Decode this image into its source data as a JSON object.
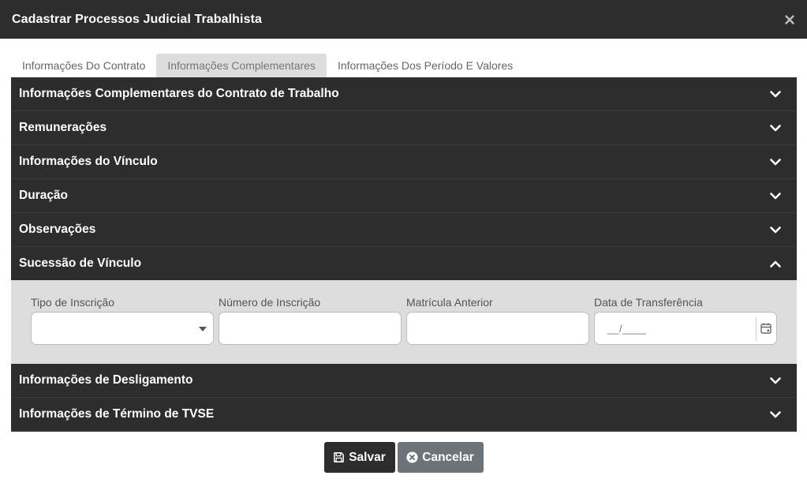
{
  "modal": {
    "title": "Cadastrar Processos Judicial Trabalhista",
    "close_icon": "close-icon"
  },
  "tabs": [
    {
      "label": "Informações Do Contrato",
      "active": false
    },
    {
      "label": "Informações Complementares",
      "active": true
    },
    {
      "label": "Informações Dos Período E Valores",
      "active": false
    }
  ],
  "sections_before": [
    {
      "title": "Informações Complementares do Contrato de Trabalho",
      "icon": "chevron-down-icon"
    },
    {
      "title": "Remunerações",
      "icon": "chevron-down-icon"
    },
    {
      "title": "Informações do Vínculo",
      "icon": "chevron-down-icon"
    },
    {
      "title": "Duração",
      "icon": "chevron-down-icon"
    },
    {
      "title": "Observações",
      "icon": "chevron-down-icon"
    }
  ],
  "open_section": {
    "title": "Sucessão de Vínculo",
    "icon": "chevron-up-icon",
    "fields": {
      "tipo_inscricao": {
        "label": "Tipo de Inscrição",
        "value": ""
      },
      "numero_inscricao": {
        "label": "Número de Inscrição",
        "value": ""
      },
      "matricula_anterior": {
        "label": "Matrícula Anterior",
        "value": ""
      },
      "data_transferencia": {
        "label": "Data de Transferência",
        "placeholder": "__/____",
        "icon": "calendar-icon"
      }
    }
  },
  "sections_after": [
    {
      "title": "Informações de Desligamento",
      "icon": "chevron-down-icon"
    },
    {
      "title": "Informações de Término de TVSE",
      "icon": "chevron-down-icon"
    }
  ],
  "footer": {
    "save_label": "Salvar",
    "save_icon": "floppy-disk-icon",
    "cancel_label": "Cancelar",
    "cancel_icon": "x-circle-icon",
    "colors": {
      "dark": "#2d2d2d",
      "cancel": "#6c7479",
      "panel": "#dddddd"
    }
  }
}
